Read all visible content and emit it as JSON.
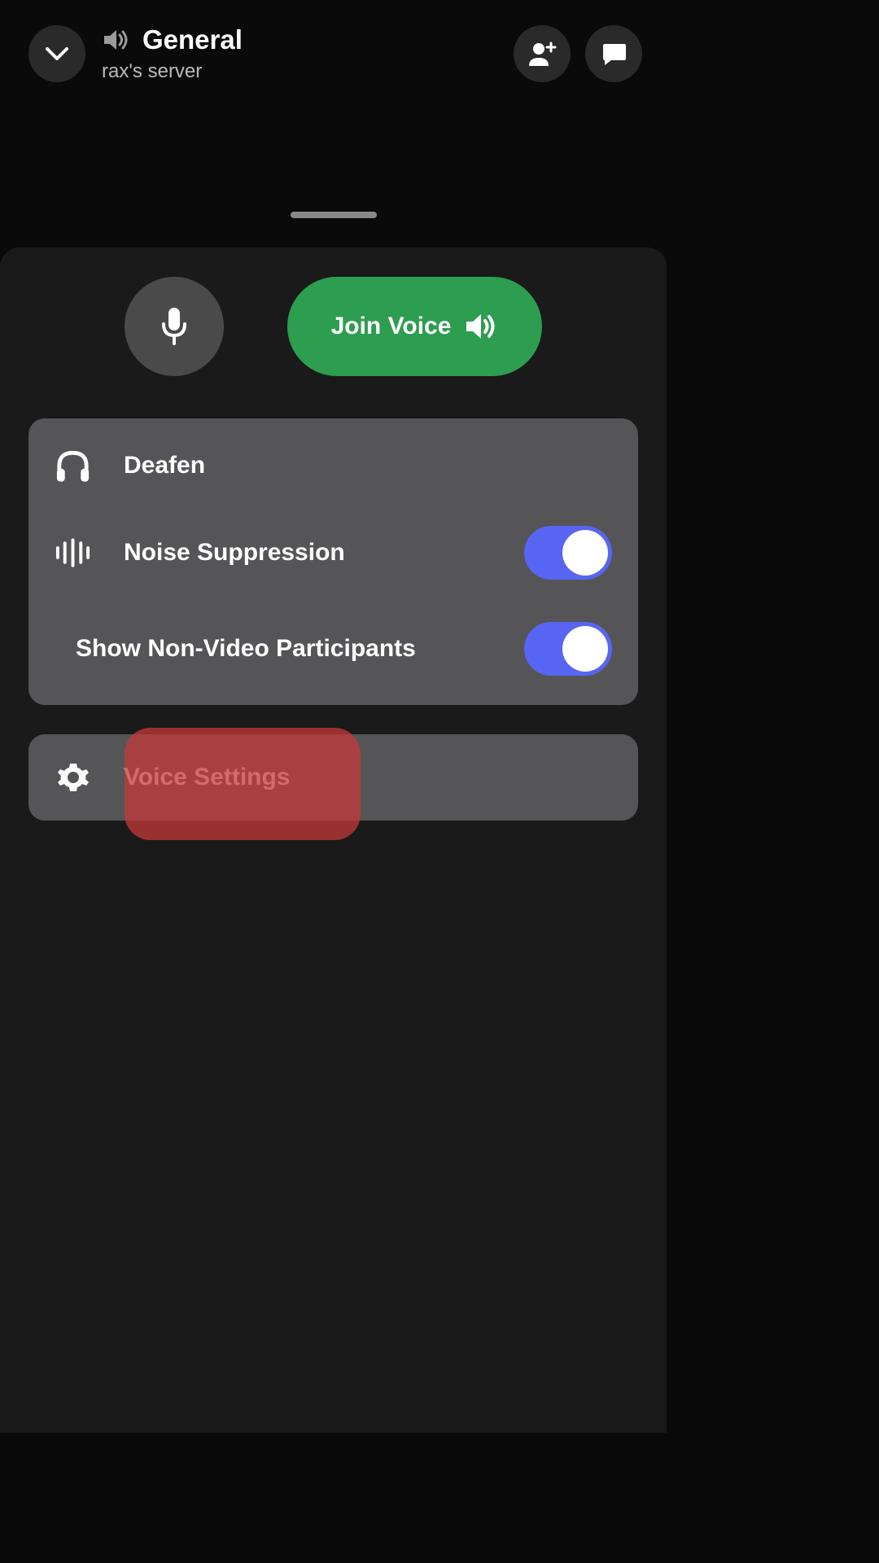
{
  "header": {
    "channel_name": "General",
    "server_name": "rax's server"
  },
  "actions": {
    "join_voice_label": "Join Voice"
  },
  "settings": {
    "deafen_label": "Deafen",
    "noise_suppression_label": "Noise Suppression",
    "noise_suppression_on": true,
    "show_non_video_label": "Show Non-Video Participants",
    "show_non_video_on": true
  },
  "voice_settings": {
    "label": "Voice Settings"
  }
}
